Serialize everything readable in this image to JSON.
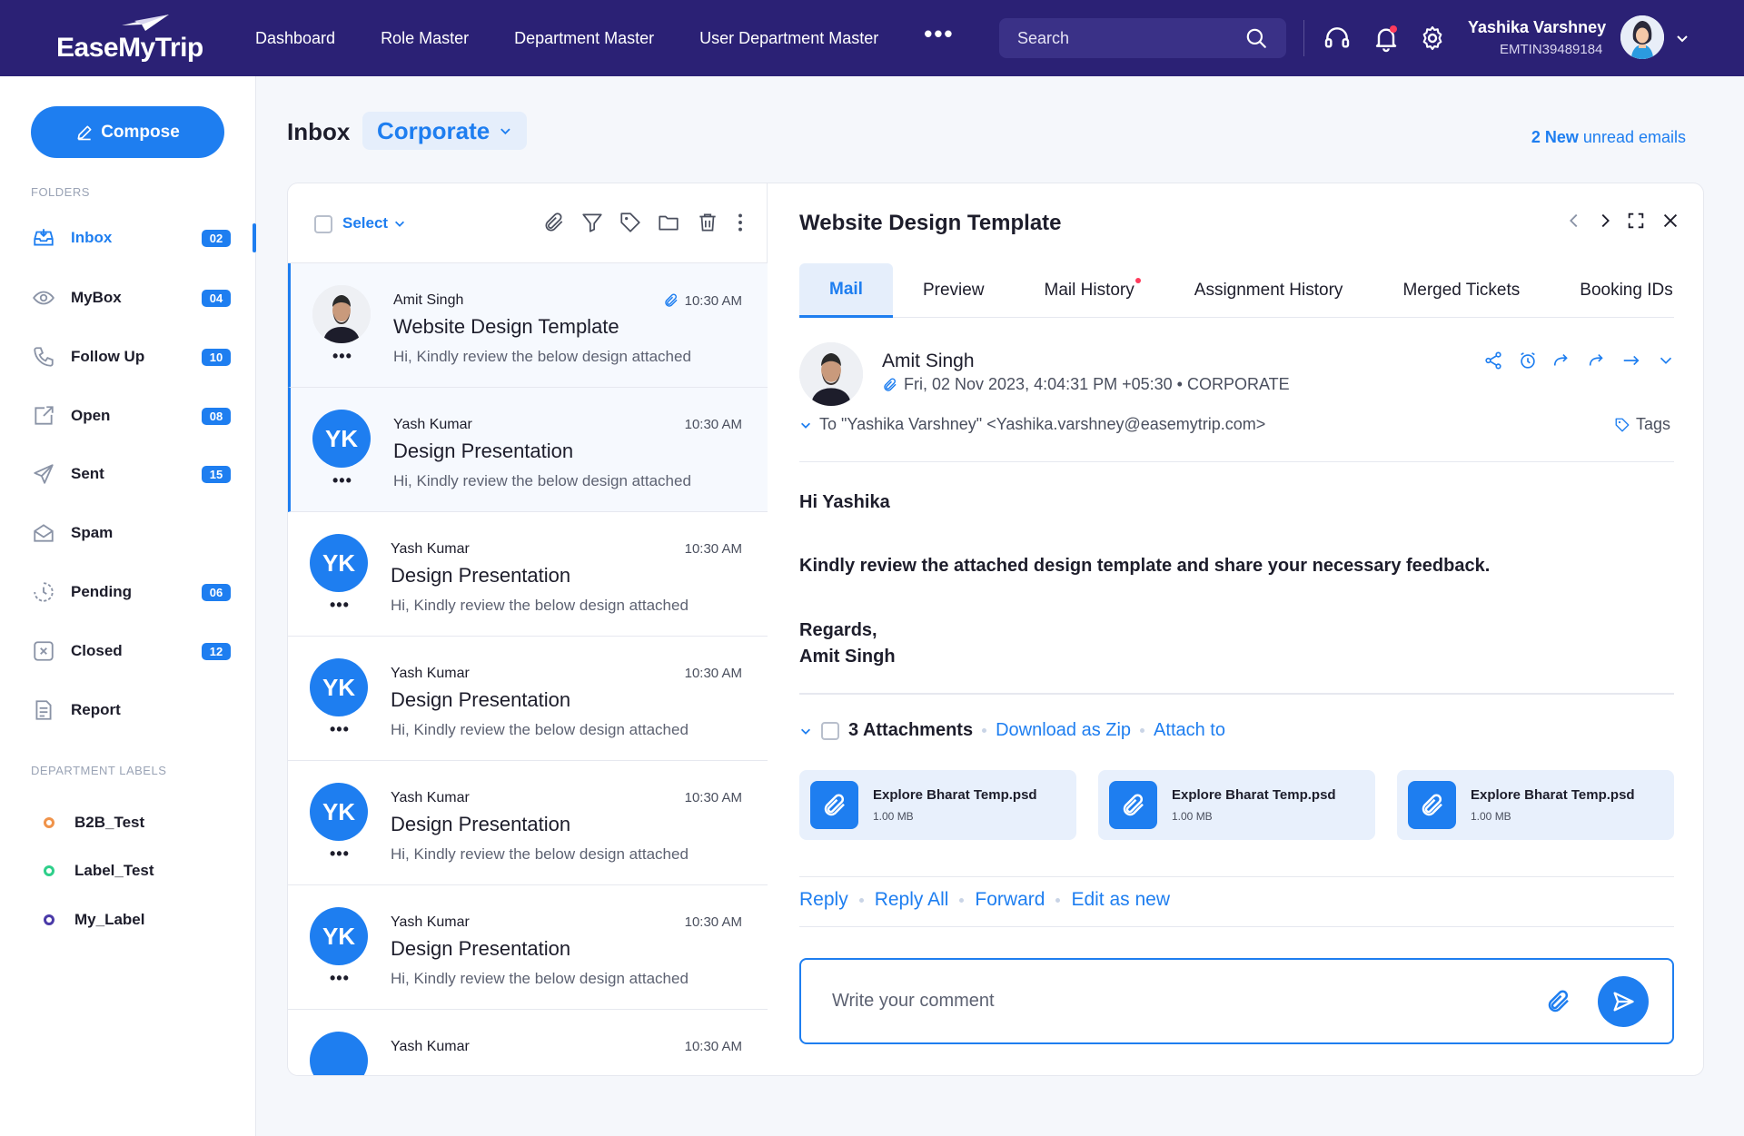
{
  "app": {
    "logo_text": "EaseMyTrip"
  },
  "topnav": {
    "items": [
      "Dashboard",
      "Role Master",
      "Department Master",
      "User Department Master"
    ],
    "more": "•••",
    "search_placeholder": "Search"
  },
  "user": {
    "name": "Yashika Varshney",
    "id": "EMTIN39489184"
  },
  "sidebar": {
    "compose_label": "Compose",
    "folders_heading": "FOLDERS",
    "folders": [
      {
        "label": "Inbox",
        "count": "02",
        "icon": "inbox-icon",
        "active": true
      },
      {
        "label": "MyBox",
        "count": "04",
        "icon": "eye-icon"
      },
      {
        "label": "Follow Up",
        "count": "10",
        "icon": "phone-icon"
      },
      {
        "label": "Open",
        "count": "08",
        "icon": "open-icon"
      },
      {
        "label": "Sent",
        "count": "15",
        "icon": "send-icon"
      },
      {
        "label": "Spam",
        "count": "",
        "icon": "spam-icon"
      },
      {
        "label": "Pending",
        "count": "06",
        "icon": "pending-icon"
      },
      {
        "label": "Closed",
        "count": "12",
        "icon": "closed-icon"
      },
      {
        "label": "Report",
        "count": "",
        "icon": "report-icon"
      }
    ],
    "labels_heading": "DEPARTMENT LABELS",
    "labels": [
      {
        "label": "B2B_Test",
        "color": "#f0934a"
      },
      {
        "label": "Label_Test",
        "color": "#2ecf8a"
      },
      {
        "label": "My_Label",
        "color": "#4a3aa8"
      }
    ]
  },
  "header": {
    "title": "Inbox",
    "dropdown": "Corporate",
    "unread_count": "2 New",
    "unread_text": " unread emails"
  },
  "list": {
    "select_label": "Select",
    "items": [
      {
        "from": "Amit Singh",
        "time": "10:30 AM",
        "subject": "Website Design Template",
        "preview": "Hi, Kindly review the below design attached",
        "initials": "",
        "attachment": true
      },
      {
        "from": "Yash Kumar",
        "time": "10:30 AM",
        "subject": "Design Presentation",
        "preview": "Hi, Kindly review the below design attached",
        "initials": "YK"
      },
      {
        "from": "Yash Kumar",
        "time": "10:30 AM",
        "subject": "Design Presentation",
        "preview": "Hi, Kindly review the below design attached",
        "initials": "YK"
      },
      {
        "from": "Yash Kumar",
        "time": "10:30 AM",
        "subject": "Design Presentation",
        "preview": "Hi, Kindly review the below design attached",
        "initials": "YK"
      },
      {
        "from": "Yash Kumar",
        "time": "10:30 AM",
        "subject": "Design Presentation",
        "preview": "Hi, Kindly review the below design attached",
        "initials": "YK"
      },
      {
        "from": "Yash Kumar",
        "time": "10:30 AM",
        "subject": "Design Presentation",
        "preview": "Hi, Kindly review the below design attached",
        "initials": "YK"
      },
      {
        "from": "Yash Kumar",
        "time": "10:30 AM",
        "subject": "",
        "preview": "",
        "initials": ""
      }
    ],
    "dots": "•••"
  },
  "detail": {
    "title": "Website Design Template",
    "tabs": [
      "Mail",
      "Preview",
      "Mail History",
      "Assignment History",
      "Merged Tickets",
      "Booking IDs"
    ],
    "sender": "Amit Singh",
    "meta": "Fri, 02 Nov 2023, 4:04:31 PM +05:30 • CORPORATE",
    "to": "To \"Yashika Varshney\" <Yashika.varshney@easemytrip.com>",
    "tags_label": "Tags",
    "body": {
      "greeting": "Hi Yashika",
      "message": "Kindly review the attached design template and share your necessary feedback.",
      "closing": "Regards,",
      "signature": "Amit Singh"
    },
    "attachments_label": "3 Attachments",
    "download_zip": "Download as Zip",
    "attach_to": "Attach to",
    "attachments": [
      {
        "name": "Explore Bharat Temp.psd",
        "size": "1.00 MB"
      },
      {
        "name": "Explore Bharat Temp.psd",
        "size": "1.00 MB"
      },
      {
        "name": "Explore Bharat Temp.psd",
        "size": "1.00 MB"
      }
    ],
    "actions": [
      "Reply",
      "Reply All",
      "Forward",
      "Edit as new"
    ],
    "comment_placeholder": "Write your comment"
  },
  "colors": {
    "topbar": "#2b2175",
    "accent": "#1e7ef0"
  }
}
